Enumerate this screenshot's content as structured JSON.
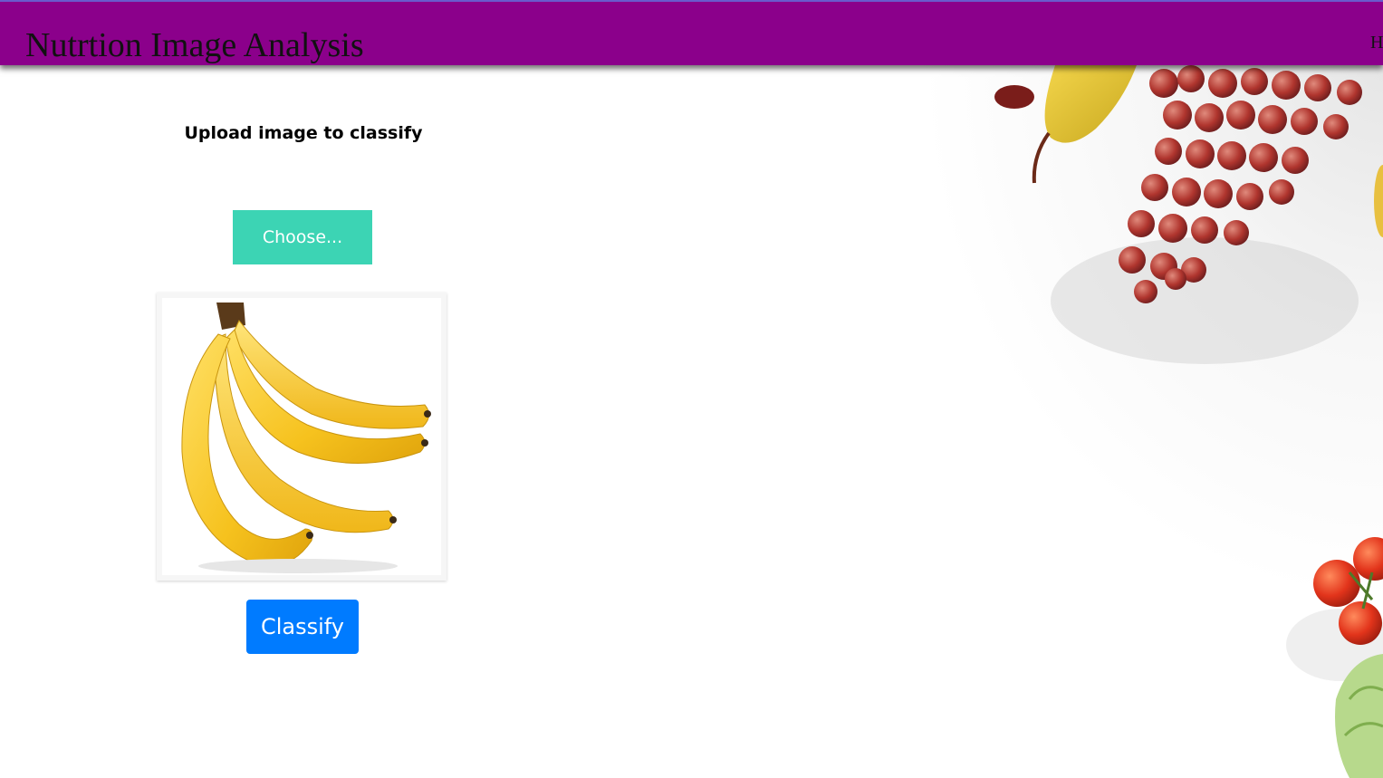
{
  "header": {
    "brand": "Nutrtion Image Analysis",
    "nav_home": "H",
    "bar_color": "#8b008b"
  },
  "upload": {
    "title": "Upload image to classify",
    "choose_label": "Choose...",
    "classify_label": "Classify",
    "choose_color": "#3cd4b4",
    "classify_color": "#007bff"
  },
  "preview": {
    "subject_icon": "banana-bunch-image"
  },
  "background": {
    "decoration": "fruit-border-image"
  }
}
